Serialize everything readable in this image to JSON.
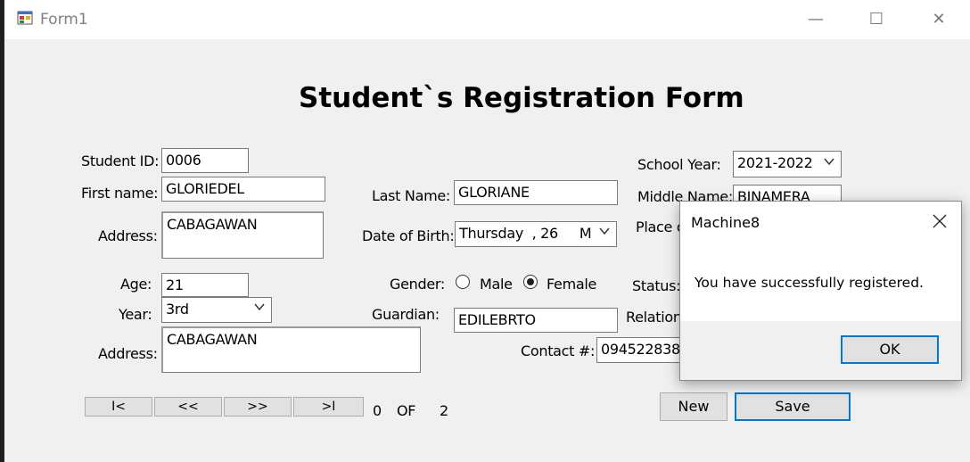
{
  "window": {
    "title": "Form1",
    "minimize_symbol": "—",
    "maximize_symbol": "☐",
    "close_symbol": "✕"
  },
  "form": {
    "title": "Student`s Registration Form",
    "labels": {
      "student_id": "Student ID:",
      "first_name": "First name:",
      "address1": "Address:",
      "age": "Age:",
      "year": "Year:",
      "address2": "Address:",
      "last_name": "Last Name:",
      "dob": "Date of Birth:",
      "gender": "Gender:",
      "guardian": "Guardian:",
      "contact": "Contact #:",
      "school_year": "School Year:",
      "middle_name": "Middle Name:",
      "place": "Place o",
      "status": "Status:",
      "relation": "Relation:"
    },
    "values": {
      "student_id": "0006",
      "first_name": "GLORIEDEL",
      "address1": "CABAGAWAN",
      "age": "21",
      "year": "3rd",
      "address2": "CABAGAWAN",
      "last_name": "GLORIANE",
      "dob": "Thursday  , 26     M",
      "guardian": "EDILEBRTO",
      "contact": "0945228381",
      "school_year": "2021-2022",
      "middle_name": "BINAMERA"
    },
    "gender": {
      "male_label": "Male",
      "female_label": "Female",
      "selected": "Female"
    },
    "navigation": {
      "first": "I<",
      "prev": "<<",
      "next": ">>",
      "last": ">I",
      "current": "0",
      "of_label": "OF",
      "total": "2"
    },
    "buttons": {
      "new": "New",
      "save": "Save"
    }
  },
  "dialog": {
    "title": "Machine8",
    "message": "You have successfully registered.",
    "ok_label": "OK"
  },
  "colors": {
    "accent": "#0078d7",
    "window_bg": "#f0f0f0",
    "button_bg": "#e1e1e1"
  }
}
